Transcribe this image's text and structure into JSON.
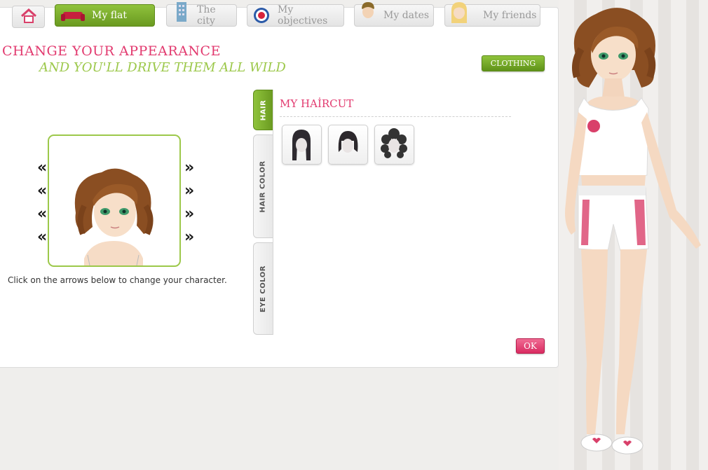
{
  "nav": {
    "home_label": "",
    "items": [
      {
        "label": "My flat",
        "icon": "sofa-icon",
        "active": true
      },
      {
        "label": "The city",
        "icon": "building-icon",
        "active": false
      },
      {
        "label": "My objectives",
        "icon": "target-icon",
        "active": false
      },
      {
        "label": "My dates",
        "icon": "boy-avatar-icon",
        "active": false
      },
      {
        "label": "My friends",
        "icon": "girl-avatar-icon",
        "active": false
      }
    ]
  },
  "header": {
    "title": "CHANGE YOUR APPEARANCE",
    "subtitle": "AND YOU'LL DRIVE THEM ALL WILD",
    "clothing_label": "CLOTHING"
  },
  "editor": {
    "hint": "Click on the arrows below to change your character.",
    "arrow_left": "«",
    "arrow_right": "»"
  },
  "tabs": [
    {
      "label": "HAIR",
      "active": true
    },
    {
      "label": "HAIR COLOR",
      "active": false
    },
    {
      "label": "EYE COLOR",
      "active": false
    }
  ],
  "section": {
    "title": "MY HAİRCUT",
    "options": [
      "long-straight-hair",
      "short-bob-hair",
      "curly-hair"
    ]
  },
  "ok_label": "OK",
  "colors": {
    "pink": "#e23a6f",
    "green": "#9cc84a",
    "button_green": "#6a9a20"
  }
}
